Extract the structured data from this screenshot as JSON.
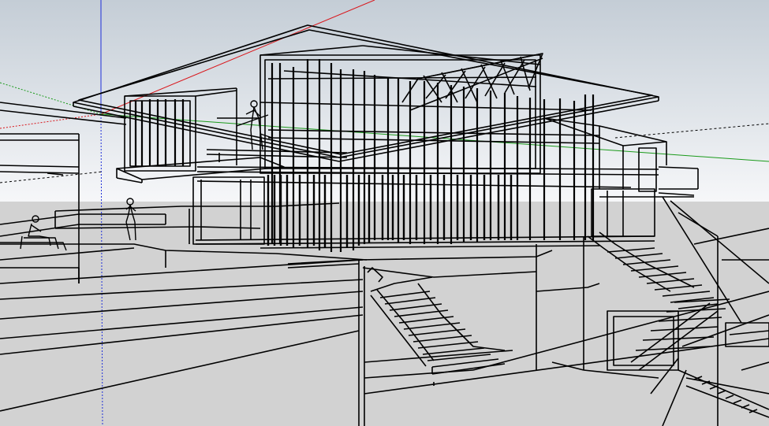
{
  "viewport": {
    "style": "wireframe",
    "sky_top_color": "#c4cdd6",
    "sky_bottom_color": "#f6f7f9",
    "ground_color": "#d2d2d2",
    "edge_color": "#000000",
    "axes": {
      "red": "#d9161b",
      "green": "#1a9a1a",
      "blue": "#1f2fd9"
    }
  }
}
